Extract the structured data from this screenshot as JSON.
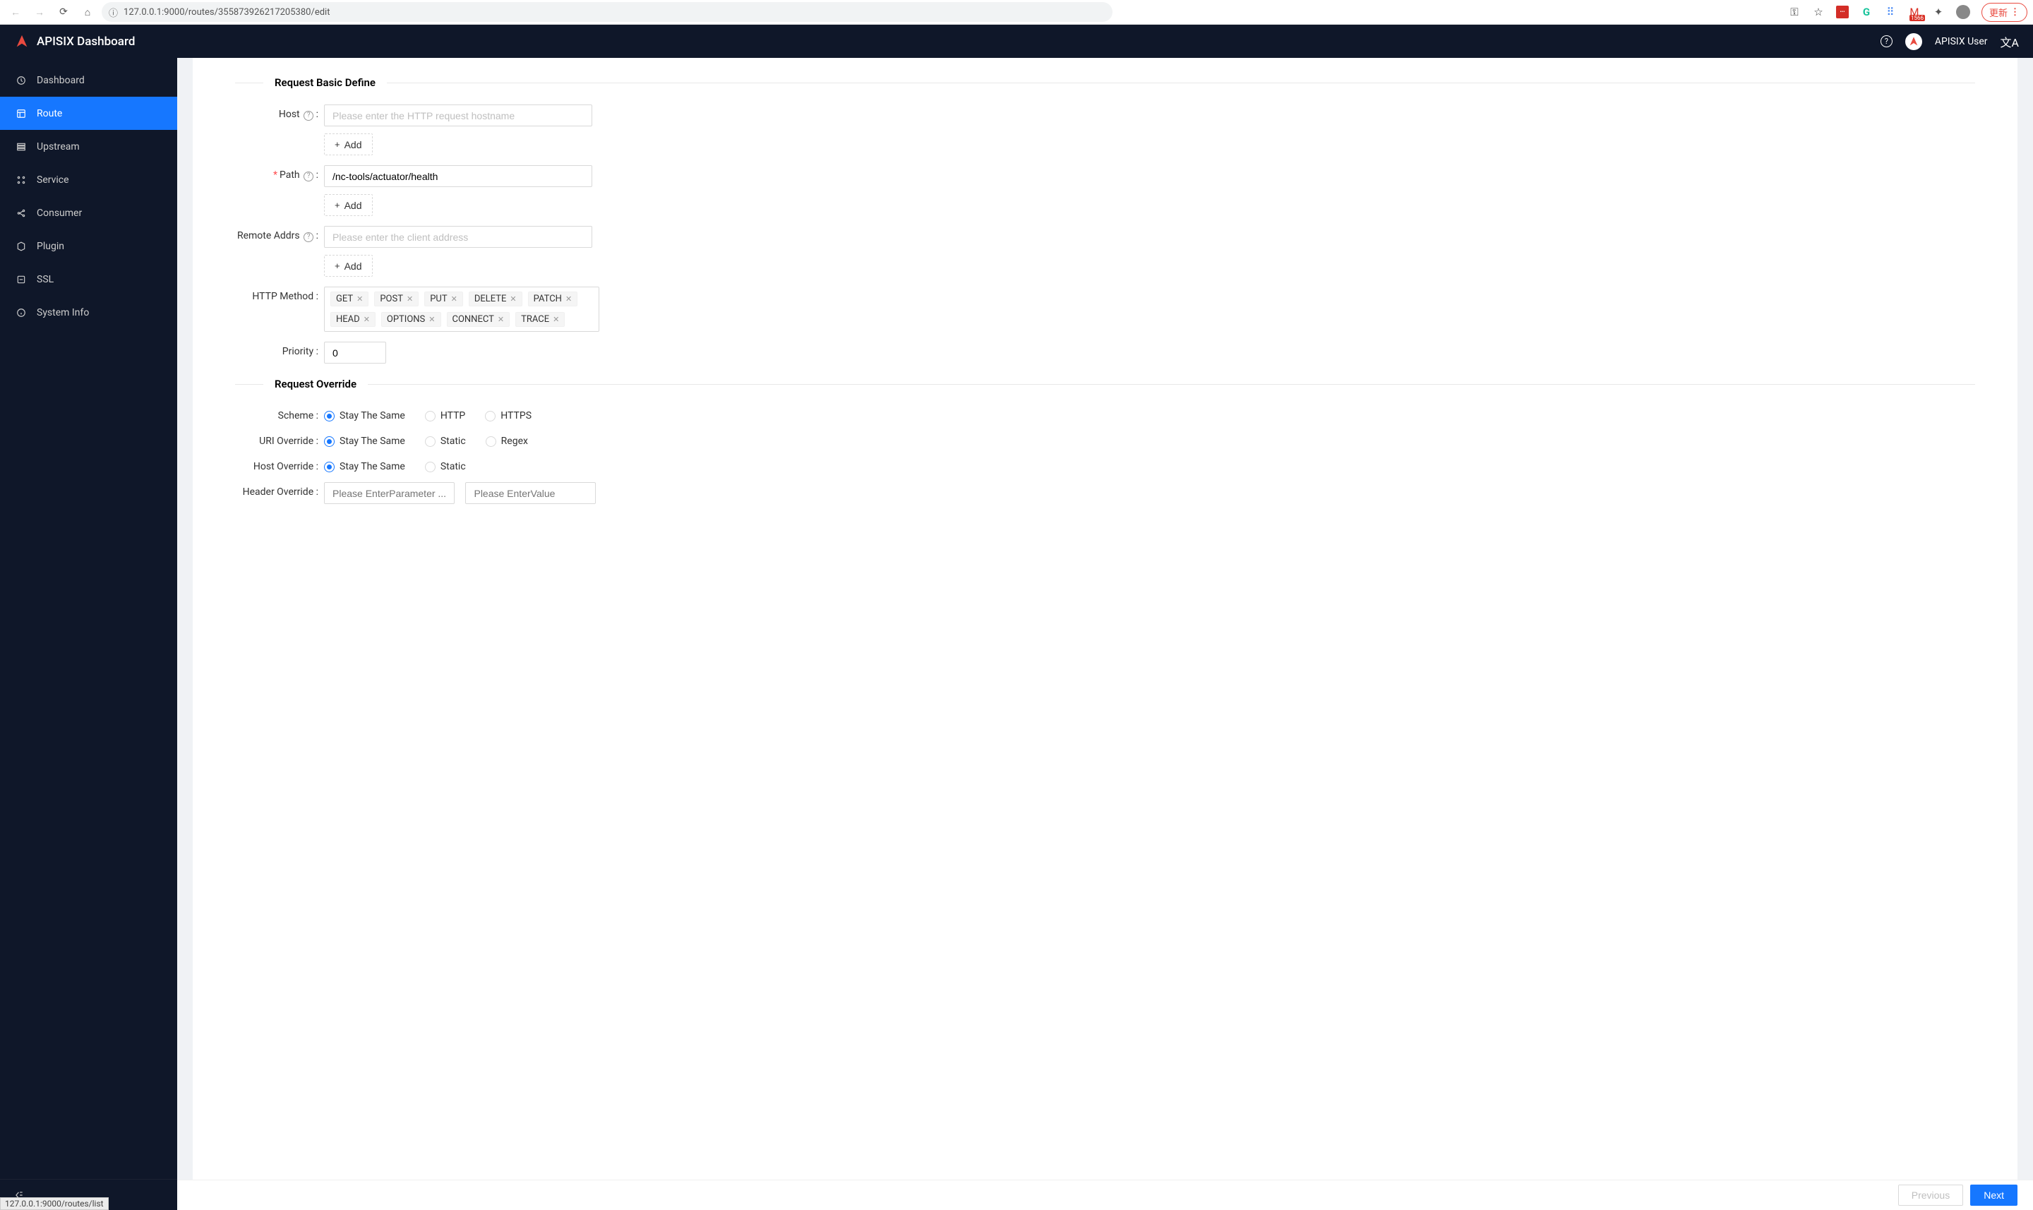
{
  "browser": {
    "url": "127.0.0.1:9000/routes/355873926217205380/edit",
    "update_label": "更新",
    "gmail_badge": "1566"
  },
  "header": {
    "title": "APISIX Dashboard",
    "user": "APISIX User"
  },
  "sidebar": {
    "items": [
      {
        "label": "Dashboard"
      },
      {
        "label": "Route"
      },
      {
        "label": "Upstream"
      },
      {
        "label": "Service"
      },
      {
        "label": "Consumer"
      },
      {
        "label": "Plugin"
      },
      {
        "label": "SSL"
      },
      {
        "label": "System Info"
      }
    ]
  },
  "sections": {
    "basic": "Request Basic Define",
    "override": "Request Override"
  },
  "labels": {
    "host": "Host",
    "path": "Path",
    "remote_addrs": "Remote Addrs",
    "http_method": "HTTP Method",
    "priority": "Priority",
    "scheme": "Scheme",
    "uri_override": "URI Override",
    "host_override": "Host Override",
    "header_override": "Header Override"
  },
  "placeholders": {
    "host": "Please enter the HTTP request hostname",
    "remote_addrs": "Please enter the client address",
    "header_param": "Please EnterParameter ...",
    "header_value": "Please EnterValue"
  },
  "values": {
    "path": "/nc-tools/actuator/health",
    "priority": "0"
  },
  "http_methods": [
    "GET",
    "POST",
    "PUT",
    "DELETE",
    "PATCH",
    "HEAD",
    "OPTIONS",
    "CONNECT",
    "TRACE"
  ],
  "radio": {
    "stay_same": "Stay The Same",
    "http": "HTTP",
    "https": "HTTPS",
    "static": "Static",
    "regex": "Regex"
  },
  "buttons": {
    "add": "Add",
    "previous": "Previous",
    "next": "Next"
  },
  "status_tip": "127.0.0.1:9000/routes/list"
}
